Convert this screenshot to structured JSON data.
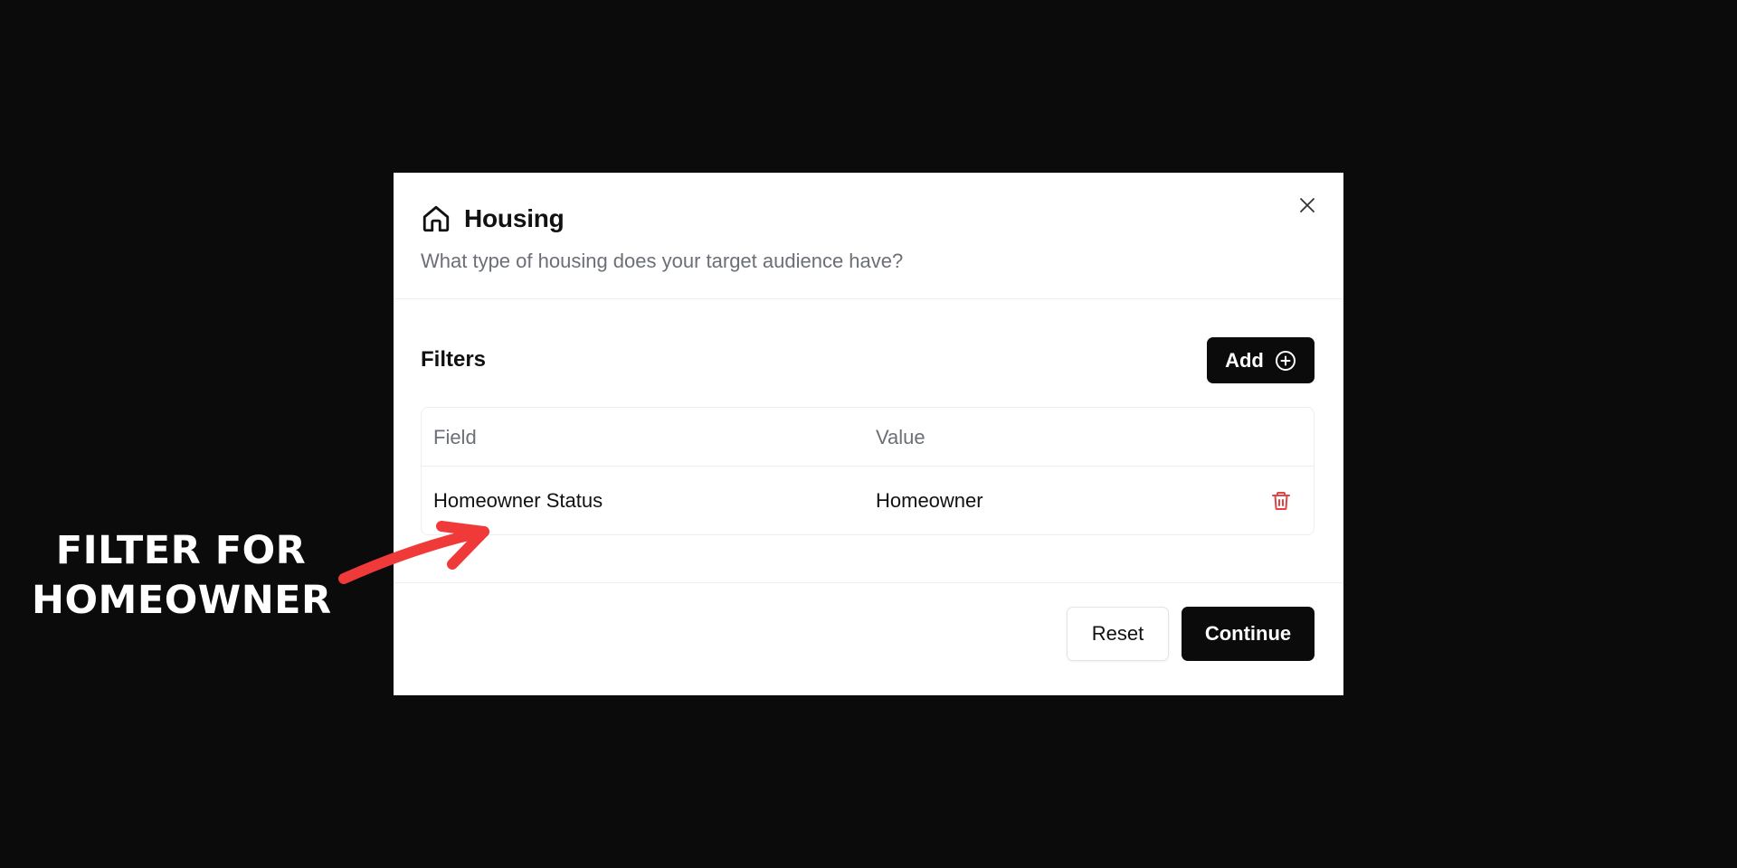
{
  "modal": {
    "title": "Housing",
    "subtitle": "What type of housing does your target audience have?",
    "icon": "home-icon",
    "close_icon": "close-icon"
  },
  "filters": {
    "label": "Filters",
    "add_label": "Add",
    "add_icon": "plus-circle-icon",
    "columns": [
      "Field",
      "Value"
    ],
    "rows": [
      {
        "field": "Homeowner Status",
        "value": "Homeowner",
        "delete_icon": "trash-icon"
      }
    ]
  },
  "footer": {
    "reset_label": "Reset",
    "continue_label": "Continue"
  },
  "annotation": {
    "line1": "FILTER FOR",
    "line2": "HOMEOWNER",
    "arrow_color": "#f03a3a"
  },
  "colors": {
    "backdrop": "#0b0b0b",
    "primary_button": "#0b0b0b",
    "danger": "#e04444",
    "muted_text": "#6b6f76"
  }
}
